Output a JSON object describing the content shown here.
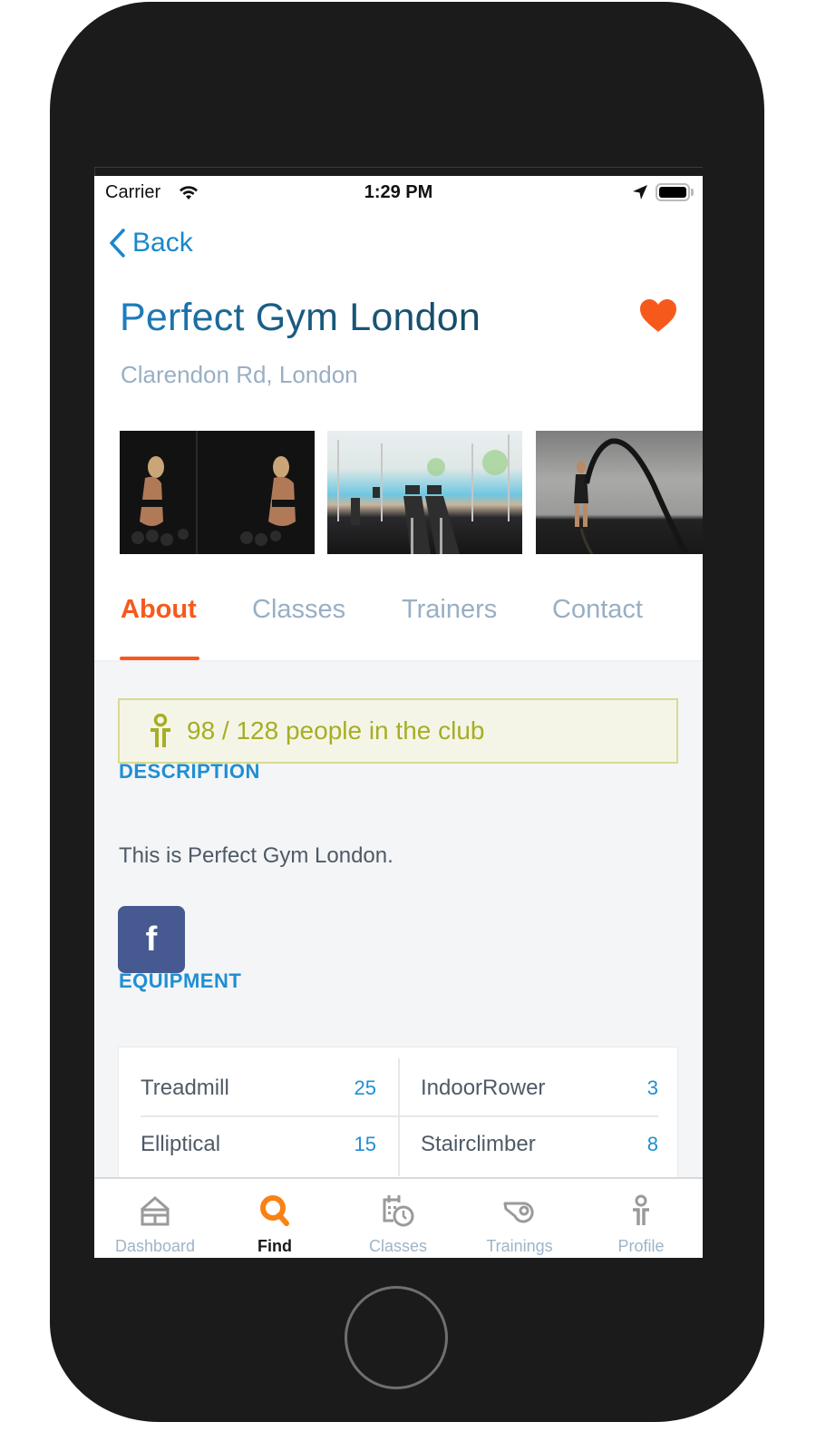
{
  "status_bar": {
    "carrier": "Carrier",
    "time": "1:29 PM",
    "wifi_icon": "wifi-icon",
    "location_icon": "location-arrow-icon",
    "battery_icon": "battery-full-icon"
  },
  "nav": {
    "back_label": "Back",
    "back_icon": "chevron-left-icon"
  },
  "club": {
    "name": "Perfect Gym London",
    "address": "Clarendon Rd, London",
    "favorite": true,
    "favorite_icon": "heart-icon"
  },
  "gallery": {
    "photos": [
      {
        "alt": "Woman training with dumbbells in front of mirror"
      },
      {
        "alt": "Gym with treadmills overlooking a pool"
      },
      {
        "alt": "Woman training with battle rope"
      }
    ]
  },
  "tabs": [
    {
      "label": "About",
      "active": true
    },
    {
      "label": "Classes",
      "active": false
    },
    {
      "label": "Trainers",
      "active": false
    },
    {
      "label": "Contact",
      "active": false
    }
  ],
  "occupancy": {
    "text": "98 / 128 people in the club",
    "current": 98,
    "capacity": 128,
    "icon": "person-icon"
  },
  "description": {
    "heading": "DESCRIPTION",
    "text": "This is Perfect Gym London."
  },
  "social": {
    "facebook_glyph": "f",
    "icon": "facebook-icon"
  },
  "equipment": {
    "heading": "EQUIPMENT",
    "items": [
      {
        "name": "Treadmill",
        "count": "25"
      },
      {
        "name": "IndoorRower",
        "count": "3"
      },
      {
        "name": "Elliptical",
        "count": "15"
      },
      {
        "name": "Stairclimber",
        "count": "8"
      }
    ]
  },
  "tabbar": [
    {
      "label": "Dashboard",
      "icon": "home-icon",
      "active": false
    },
    {
      "label": "Find",
      "icon": "search-icon",
      "active": true
    },
    {
      "label": "Classes",
      "icon": "calendar-clock-icon",
      "active": false
    },
    {
      "label": "Trainings",
      "icon": "whistle-icon",
      "active": false
    },
    {
      "label": "Profile",
      "icon": "person-icon",
      "active": false
    }
  ],
  "colors": {
    "accent": "#f7591d",
    "link": "#1b87c9",
    "section": "#1f8fd3",
    "muted": "#98afc4",
    "occupancy_text": "#a6ae25",
    "occupancy_bg": "#f5f5e7",
    "facebook": "#465a91"
  }
}
